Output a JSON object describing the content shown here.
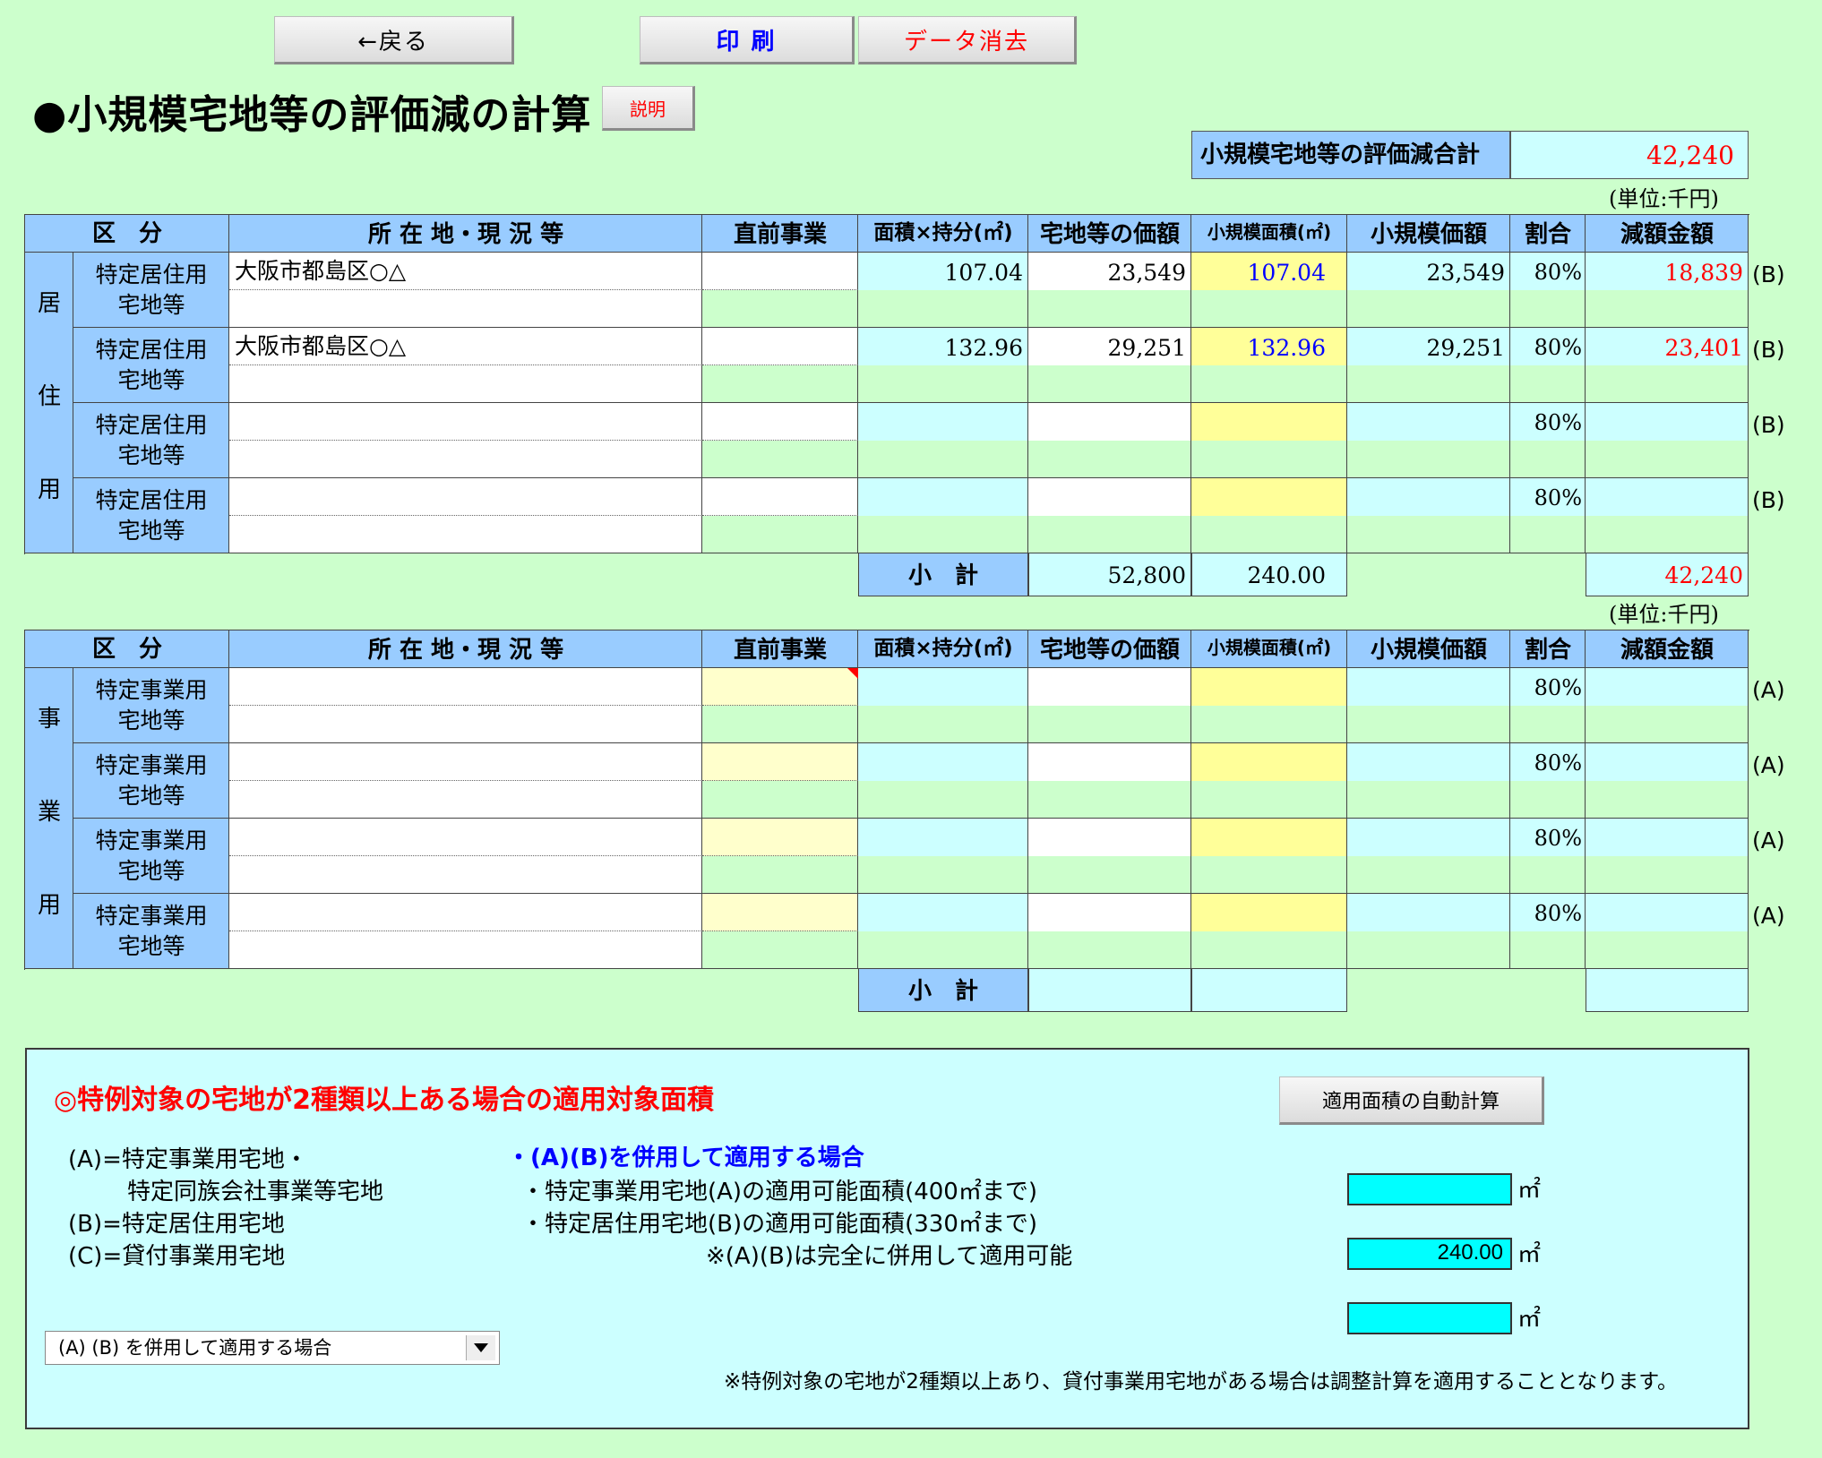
{
  "toolbar": {
    "back_label": "←戻る",
    "print_label": "印 刷",
    "clear_label": "データ消去",
    "explain_label": "説明"
  },
  "page_title": "●小規模宅地等の評価減の計算",
  "total": {
    "label": "小規模宅地等の評価減合計",
    "value": "42,240"
  },
  "unit_label": "(単位:千円)",
  "headers": {
    "kubun": "区　分",
    "location": "所 在 地・現 況 等",
    "prior_business": "直前事業",
    "area_share": "面積×持分(㎡)",
    "land_value": "宅地等の価額",
    "small_area": "小規模面積(㎡)",
    "small_value": "小規模価額",
    "ratio": "割合",
    "reduction": "減額金額"
  },
  "residential": {
    "group_chars": [
      "居",
      "住",
      "用"
    ],
    "rows": [
      {
        "type1": "特定居住用",
        "type2": "宅地等",
        "location": "大阪市都島区○△",
        "area": "107.04",
        "value": "23,549",
        "small_area": "107.04",
        "small_value": "23,549",
        "ratio": "80%",
        "reduction": "18,839",
        "mark": "(B)"
      },
      {
        "type1": "特定居住用",
        "type2": "宅地等",
        "location": "大阪市都島区○△",
        "area": "132.96",
        "value": "29,251",
        "small_area": "132.96",
        "small_value": "29,251",
        "ratio": "80%",
        "reduction": "23,401",
        "mark": "(B)"
      },
      {
        "type1": "特定居住用",
        "type2": "宅地等",
        "location": "",
        "area": "",
        "value": "",
        "small_area": "",
        "small_value": "",
        "ratio": "80%",
        "reduction": "",
        "mark": "(B)"
      },
      {
        "type1": "特定居住用",
        "type2": "宅地等",
        "location": "",
        "area": "",
        "value": "",
        "small_area": "",
        "small_value": "",
        "ratio": "80%",
        "reduction": "",
        "mark": "(B)"
      }
    ],
    "subtotal": {
      "label": "小　計",
      "value": "52,800",
      "area": "240.00",
      "reduction": "42,240"
    }
  },
  "business": {
    "group_chars": [
      "事",
      "業",
      "用"
    ],
    "rows": [
      {
        "type1": "特定事業用",
        "type2": "宅地等",
        "ratio": "80%",
        "mark": "(A)"
      },
      {
        "type1": "特定事業用",
        "type2": "宅地等",
        "ratio": "80%",
        "mark": "(A)"
      },
      {
        "type1": "特定事業用",
        "type2": "宅地等",
        "ratio": "80%",
        "mark": "(A)"
      },
      {
        "type1": "特定事業用",
        "type2": "宅地等",
        "ratio": "80%",
        "mark": "(A)"
      }
    ],
    "subtotal": {
      "label": "小　計",
      "value": "",
      "area": "",
      "reduction": ""
    }
  },
  "panel": {
    "heading": "◎特例対象の宅地が2種類以上ある場合の適用対象面積",
    "auto_calc_label": "適用面積の自動計算",
    "legend": [
      "(A)=特定事業用宅地・",
      "特定同族会社事業等宅地",
      "(B)=特定居住用宅地",
      "(C)=貸付事業用宅地"
    ],
    "combined_heading": "・(A)(B)を併用して適用する場合",
    "line_a": "・特定事業用宅地(A)の適用可能面積(400㎡まで)",
    "line_b": "・特定居住用宅地(B)の適用可能面積(330㎡まで)",
    "note_ab": "※(A)(B)は完全に併用して適用可能",
    "field1": "",
    "field2": "240.00",
    "field3": "",
    "unit": "㎡",
    "dropdown_value": "(A) (B) を併用して適用する場合",
    "footnote": "※特例対象の宅地が2種類以上あり、貸付事業用宅地がある場合は調整計算を適用することとなります。"
  },
  "colors": {
    "background": "#ccffcc",
    "header": "#99ccff",
    "cyan": "#ccffff",
    "yellow": "#ffff99",
    "light_yellow": "#ffffcc",
    "red": "#ff0000",
    "blue": "#0000ff"
  }
}
